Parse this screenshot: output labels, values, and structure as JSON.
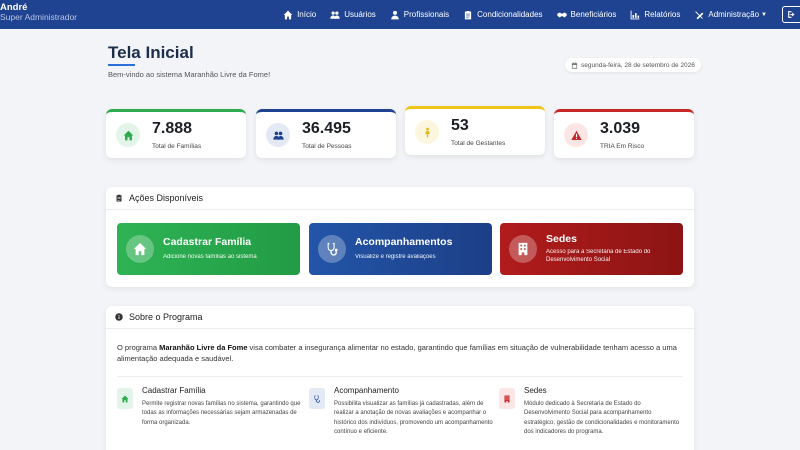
{
  "navbar": {
    "user_name": "André",
    "user_role": "Super Administrador",
    "items": [
      {
        "label": "Início",
        "icon": "home-icon"
      },
      {
        "label": "Usuários",
        "icon": "users-icon"
      },
      {
        "label": "Profissionais",
        "icon": "user-icon"
      },
      {
        "label": "Condicionalidades",
        "icon": "clipboard-icon"
      },
      {
        "label": "Beneficiários",
        "icon": "handshake-icon"
      },
      {
        "label": "Relatórios",
        "icon": "chart-icon"
      },
      {
        "label": "Administração",
        "icon": "tools-icon"
      }
    ],
    "logout_icon": "logout-icon"
  },
  "header": {
    "title": "Tela Inicial",
    "subtitle": "Bem-vindo ao sistema Maranhão Livre da Fome!",
    "date": "segunda-feira, 28 de setembro de 2026"
  },
  "stats": [
    {
      "value": "7.888",
      "label": "Total de Famílias",
      "color": "#2eaa4f"
    },
    {
      "value": "36.495",
      "label": "Total de Pessoas",
      "color": "#1f4391"
    },
    {
      "value": "53",
      "label": "Total de Gestantes",
      "color": "#f0c419"
    },
    {
      "value": "3.039",
      "label": "TRIA Em Risco",
      "color": "#c62828"
    }
  ],
  "actions": {
    "title": "Ações Disponíveis",
    "buttons": [
      {
        "title": "Cadastrar Família",
        "desc": "Adicione novas famílias ao sistema"
      },
      {
        "title": "Acompanhamentos",
        "desc": "Visualize e registre avaliações"
      },
      {
        "title": "Sedes",
        "desc": "Acesso para a Secretaria de Estado do Desenvolvimento Social"
      }
    ]
  },
  "about": {
    "title": "Sobre o Programa",
    "text_before": "O programa ",
    "program_name": "Maranhão Livre da Fome",
    "text_after": " visa combater a insegurança alimentar no estado, garantindo que famílias em situação de vulnerabilidade tenham acesso a uma alimentação adequada e saudável.",
    "features": [
      {
        "title": "Cadastrar Família",
        "desc": "Permite registrar novas famílias no sistema, garantindo que todas as informações necessárias sejam armazenadas de forma organizada."
      },
      {
        "title": "Acompanhamento",
        "desc": "Possibilita visualizar as famílias já cadastradas, além de realizar a anotação de novas avaliações e acompanhar o histórico dos indivíduos, promovendo um acompanhamento contínuo e eficiente."
      },
      {
        "title": "Sedes",
        "desc": "Módulo dedicado à Secretaria de Estado do Desenvolvimento Social para acompanhamento estratégico, gestão de condicionalidades e monitoramento dos indicadores do programa."
      }
    ]
  },
  "colors": {
    "nav_bg": "#1f4391",
    "green": "#2eaa4f",
    "blue": "#1f4391",
    "yellow": "#f0c419",
    "red": "#c62828"
  }
}
